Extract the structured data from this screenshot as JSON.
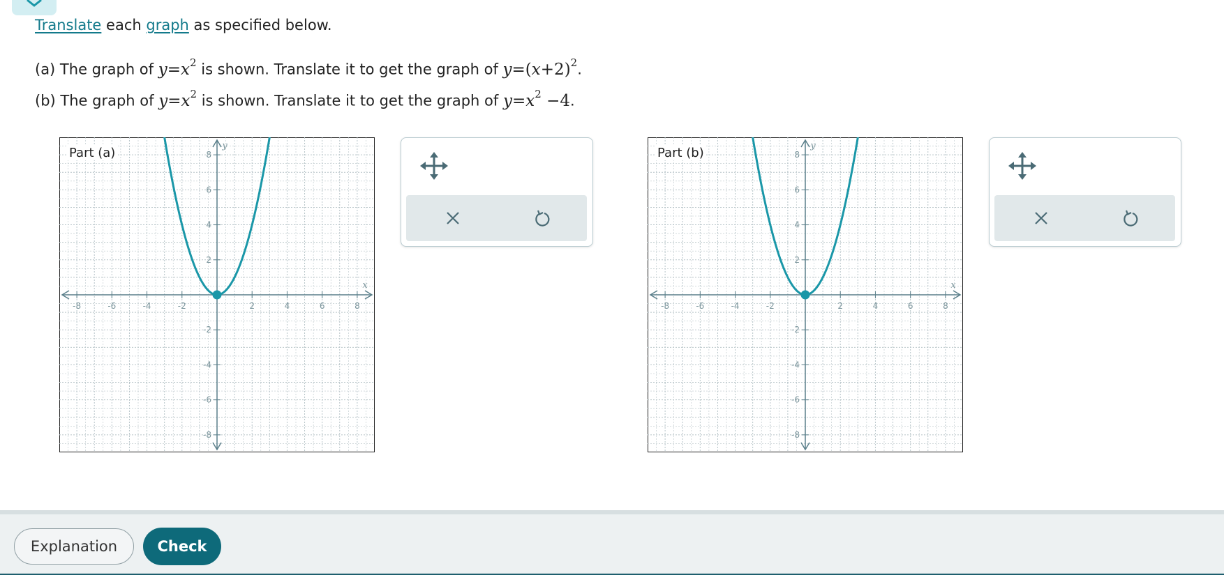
{
  "intro": {
    "link1": "Translate",
    "middle": " each ",
    "link2": "graph",
    "end": " as specified below."
  },
  "questions": {
    "a": {
      "prefix": "(a) The graph of ",
      "mid": " is shown. Translate it to get the graph of ",
      "end": "."
    },
    "b": {
      "prefix": "(b) The graph of ",
      "mid": " is shown. Translate it to get the graph of ",
      "end": "."
    }
  },
  "math": {
    "y": "y",
    "eq": "=",
    "x": "x",
    "exp": "2",
    "lparen": "(",
    "plus": "+",
    "two": "2",
    "rparen": ")",
    "minus": "−",
    "four": "4"
  },
  "graphs": [
    {
      "label": "Part (a)",
      "x_range": [
        -9,
        9
      ],
      "y_range": [
        -9,
        9
      ],
      "x_axis_label": "x",
      "y_axis_label": "y",
      "x_ticks": [
        -8,
        -6,
        -4,
        -2,
        2,
        4,
        6,
        8
      ],
      "y_ticks": [
        -8,
        -6,
        -4,
        -2,
        2,
        4,
        6,
        8
      ],
      "curve": "y = x^2",
      "vertex": [
        0,
        0
      ],
      "grid": true
    },
    {
      "label": "Part (b)",
      "x_range": [
        -9,
        9
      ],
      "y_range": [
        -9,
        9
      ],
      "x_axis_label": "x",
      "y_axis_label": "y",
      "x_ticks": [
        -8,
        -6,
        -4,
        -2,
        2,
        4,
        6,
        8
      ],
      "y_ticks": [
        -8,
        -6,
        -4,
        -2,
        2,
        4,
        6,
        8
      ],
      "curve": "y = x^2",
      "vertex": [
        0,
        0
      ],
      "grid": true
    }
  ],
  "tools": {
    "move_icon": "move-arrows-icon",
    "clear_icon": "close-x-icon",
    "undo_icon": "undo-icon"
  },
  "footer": {
    "explanation_label": "Explanation",
    "check_label": "Check"
  },
  "colors": {
    "curve": "#1a97a8",
    "axis": "#5a7f8a",
    "grid": "#b7c4c8",
    "check_bg": "#0e6a7a",
    "accent_link": "#137a8b"
  }
}
